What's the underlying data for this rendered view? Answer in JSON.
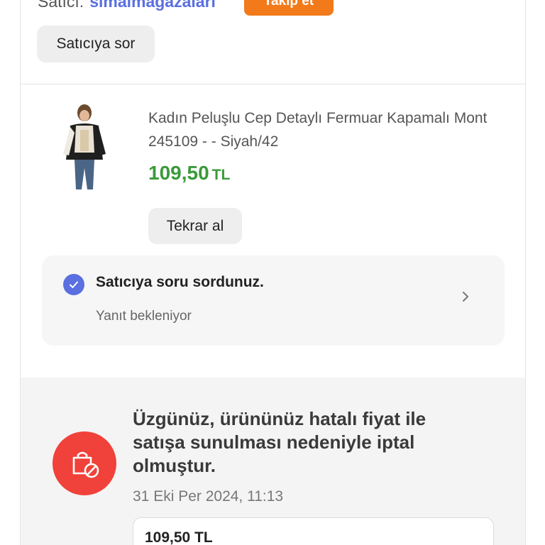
{
  "seller": {
    "prefix": "Satıcı:",
    "name": "simalmagazalari",
    "follow_label": "Takip et",
    "ask_label": "Satıcıya sor"
  },
  "product": {
    "title": "Kadın Peluşlu Cep Detaylı Fermuar Kapamalı Mont 245109 - - Siyah/42",
    "price_amount": "109,50",
    "price_currency": "TL",
    "rebuy_label": "Tekrar al"
  },
  "question": {
    "title": "Satıcıya soru sordunuz.",
    "status": "Yanıt bekleniyor"
  },
  "cancellation": {
    "message": "Üzgünüz, ürününüz hatalı fiyat ile satışa sunulması nedeniyle iptal olmuştur.",
    "date": "31 Eki Per 2024, 11:13",
    "amount": "109,50 TL"
  },
  "colors": {
    "accent": "#5a6fe0",
    "follow": "#f27a1a",
    "price": "#3a9a3a",
    "cancel": "#f0423a"
  },
  "icons": {
    "question_status": "check-circle-icon",
    "question_nav": "chevron-right-icon",
    "cancellation": "cancelled-bag-icon"
  }
}
